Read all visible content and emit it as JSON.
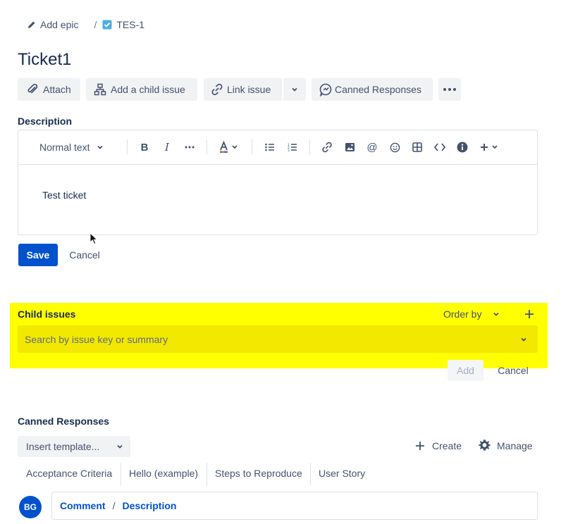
{
  "breadcrumb": {
    "add_epic": "Add epic",
    "separator": "/",
    "issue_key": "TES-1"
  },
  "issue": {
    "title": "Ticket1"
  },
  "actions": {
    "attach": "Attach",
    "add_child": "Add a child issue",
    "link_issue": "Link issue",
    "canned": "Canned Responses"
  },
  "description": {
    "label": "Description",
    "text_style": "Normal text",
    "body": "Test ticket",
    "save": "Save",
    "cancel": "Cancel"
  },
  "child_issues": {
    "title": "Child issues",
    "order_by": "Order by",
    "search_placeholder": "Search by issue key or summary",
    "add": "Add",
    "cancel": "Cancel",
    "highlight_color": "#ffff00"
  },
  "canned_responses": {
    "title": "Canned Responses",
    "insert_placeholder": "Insert template...",
    "create": "Create",
    "manage": "Manage",
    "templates": [
      "Acceptance Criteria",
      "Hello (example)",
      "Steps to Reproduce",
      "User Story"
    ]
  },
  "comment": {
    "avatar": "BG",
    "comment_link": "Comment",
    "separator": "/",
    "description_link": "Description"
  },
  "colors": {
    "primary": "#0052cc",
    "text": "#172b4d",
    "subtle": "#42526e",
    "button_bg": "#f1f2f4",
    "border": "#dfe1e6"
  }
}
